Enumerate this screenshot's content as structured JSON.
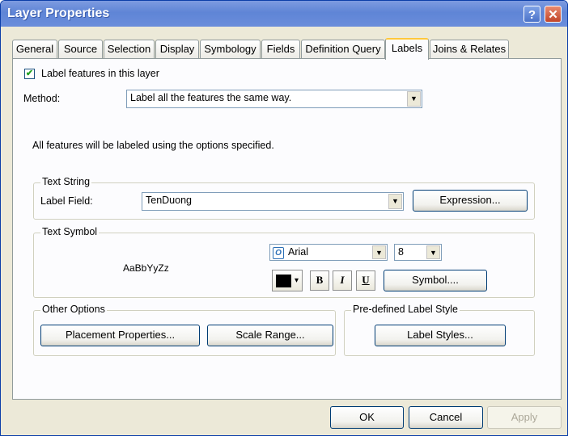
{
  "window": {
    "title": "Layer Properties",
    "help_glyph": "?",
    "close_glyph": "✕"
  },
  "tabs": [
    "General",
    "Source",
    "Selection",
    "Display",
    "Symbology",
    "Fields",
    "Definition Query",
    "Labels",
    "Joins & Relates"
  ],
  "active_tab": "Labels",
  "labels": {
    "label_features_text": "Label features in this layer",
    "label_features_checked": true,
    "method_label": "Method:",
    "method_value": "Label all the features the same way.",
    "info_text": "All features will be labeled using the options specified."
  },
  "text_string": {
    "title": "Text String",
    "field_label": "Label Field:",
    "field_value": "TenDuong",
    "expression_button": "Expression..."
  },
  "text_symbol": {
    "title": "Text Symbol",
    "preview": "AaBbYyZz",
    "font_value": "Arial",
    "size_value": "8",
    "color": "#000000",
    "bold_label": "B",
    "italic_label": "I",
    "underline_label": "U",
    "symbol_button": "Symbol...."
  },
  "other_options": {
    "title": "Other Options",
    "placement_button": "Placement Properties...",
    "scale_button": "Scale Range..."
  },
  "predefined": {
    "title": "Pre-defined Label Style",
    "styles_button": "Label Styles..."
  },
  "footer": {
    "ok": "OK",
    "cancel": "Cancel",
    "apply": "Apply"
  },
  "icons": {
    "dropdown": "▼",
    "check": "✔",
    "font_type": "O",
    "split_arrow": "▾"
  }
}
